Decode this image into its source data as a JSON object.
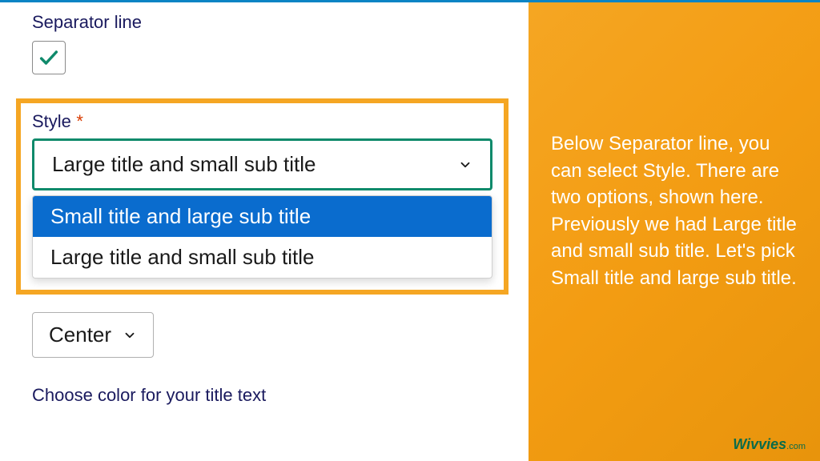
{
  "form": {
    "separator_label": "Separator line",
    "style_label": "Style",
    "required_mark": "*",
    "selected_style": "Large title and small sub title",
    "options": [
      "Small title and large sub title",
      "Large title and small sub title"
    ],
    "alignment_value": "Center",
    "color_label": "Choose color for your title text"
  },
  "sidebar": {
    "instruction": "Below Separator line, you can select Style. There are two options, shown here. Previously we had Large title and small sub title. Let's pick Small title and large sub title."
  },
  "brand": {
    "name": "Wivvies",
    "tld": ".com"
  }
}
